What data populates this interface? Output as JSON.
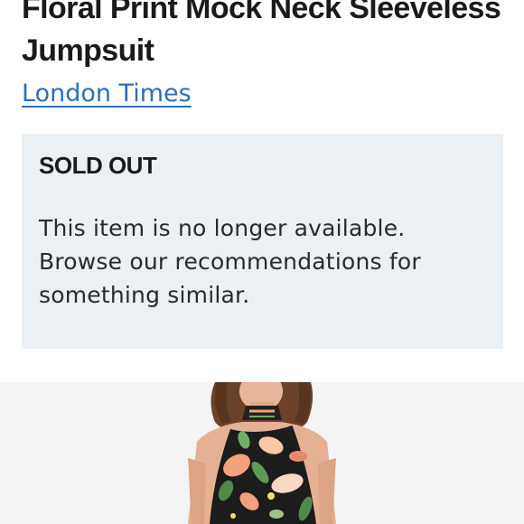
{
  "product": {
    "title": "Floral Print Mock Neck Sleeveless Jumpsuit",
    "brand": "London Times"
  },
  "availability": {
    "status": "SOLD OUT",
    "message": "This item is no longer available. Browse our recommendations for something similar."
  },
  "image": {
    "description_icon": "product-photo",
    "background_color": "#f4f4f4"
  }
}
